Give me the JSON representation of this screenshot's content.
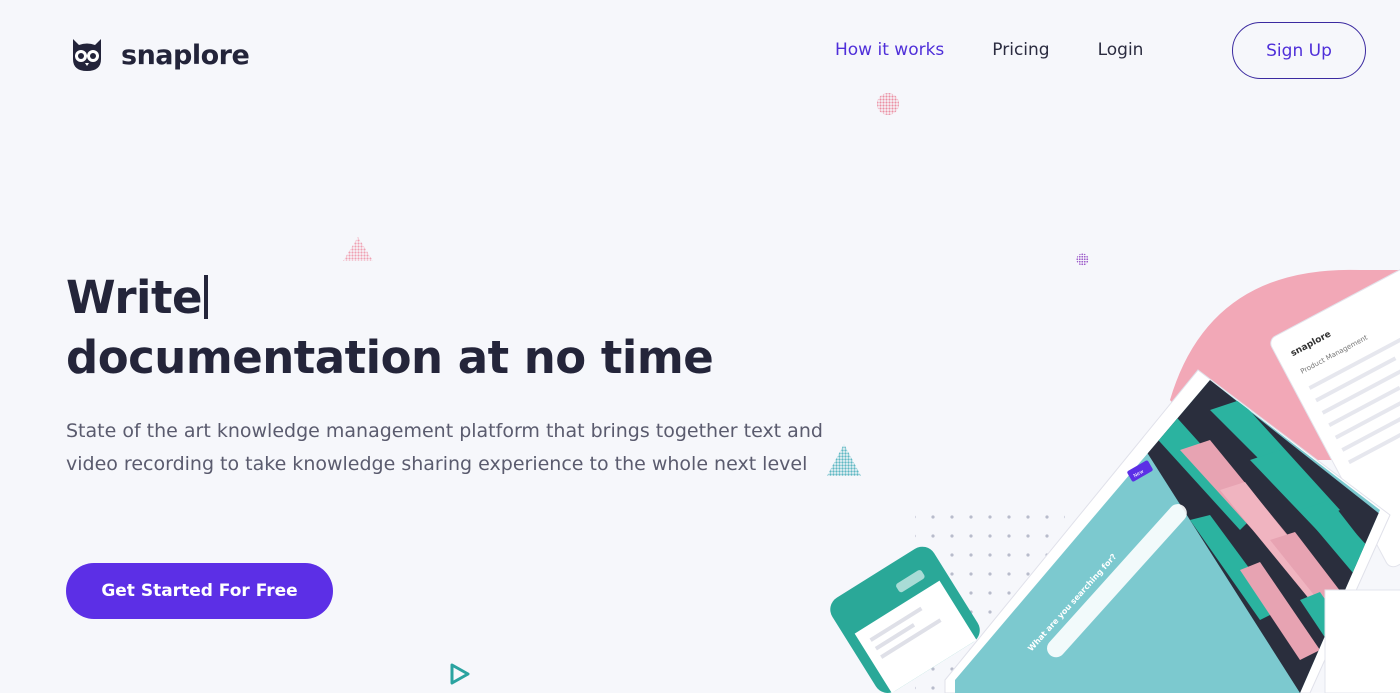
{
  "brand": {
    "name": "snaplore",
    "icon": "owl-icon"
  },
  "nav": {
    "items": [
      {
        "label": "How it works",
        "active": true
      },
      {
        "label": "Pricing",
        "active": false
      },
      {
        "label": "Login",
        "active": false
      }
    ],
    "signup_label": "Sign Up"
  },
  "hero": {
    "typed_word": "Write",
    "headline_rest": "documentation at no time",
    "subtext": "State of the art knowledge management platform that brings together text and video recording to take knowledge sharing experience to the whole next level",
    "cta_label": "Get Started For Free"
  },
  "mockup": {
    "search_prompt": "What are you searching for?",
    "brand": "snaplore",
    "section_title": "Product Management",
    "button_label": "New"
  },
  "colors": {
    "accent": "#5c2fe6",
    "nav_active": "#4f2fd9",
    "highlight_pink": "#f0a8b8",
    "teal": "#2bb3a0",
    "background": "#f6f7fb"
  }
}
